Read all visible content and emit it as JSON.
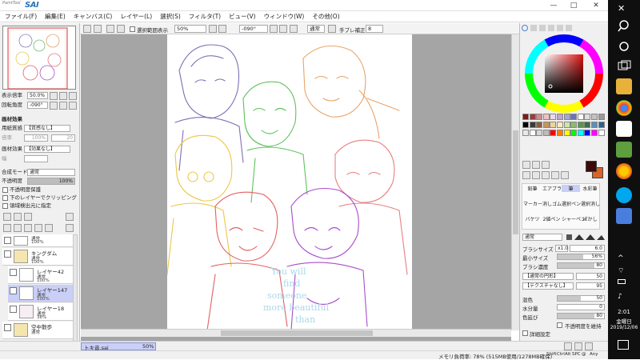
{
  "app": {
    "logo_small": "PaintTool",
    "logo_big": "SAI"
  },
  "window_buttons": {
    "minimize": "—",
    "maximize": "□",
    "close": "✕"
  },
  "menu": [
    "ファイル(F)",
    "編集(E)",
    "キャンバス(C)",
    "レイヤー(L)",
    "選択(S)",
    "フィルタ(T)",
    "ビュー(V)",
    "ウィンドウ(W)",
    "その他(O)"
  ],
  "toolbar": {
    "selection_display_label": "選択範囲表示",
    "zoom": "50%",
    "rotation": "-090°",
    "blend": "通常",
    "stabilizer_label": "手ブレ補正",
    "stabilizer_value": "8"
  },
  "navigator": {
    "zoom_label": "表示倍率",
    "zoom_value": "50.0%",
    "angle_label": "回転角度",
    "angle_value": "-090°"
  },
  "texture": {
    "section": "画材効果",
    "paper_label": "用紙質感",
    "paper_value": "【質感なし】",
    "paper_scale_label": "倍率",
    "paper_scale_value": "100%",
    "paper_strength_value": "20",
    "effect_label": "画材効果",
    "effect_value": "【効果なし】",
    "effect_scale_label": "幅"
  },
  "layer_settings": {
    "mode_label": "合成モード",
    "mode_value": "通常",
    "opacity_label": "不透明度",
    "opacity_value": "100%",
    "opts": [
      "不透明度保護",
      "下のレイヤーでクリッピング",
      "領域検出元に指定"
    ]
  },
  "layers": [
    {
      "name": "",
      "mode": "通常",
      "opacity": "100%",
      "kind": "top"
    },
    {
      "name": "キングダム",
      "mode": "通常",
      "opacity": "100%",
      "kind": "folder"
    },
    {
      "name": "レイヤー42",
      "mode": "通常",
      "opacity": "100%",
      "kind": "layer"
    },
    {
      "name": "レイヤー147",
      "mode": "通常",
      "opacity": "100%",
      "kind": "layer",
      "selected": true
    },
    {
      "name": "レイヤー18",
      "mode": "通常",
      "opacity": "38%",
      "kind": "layer"
    },
    {
      "name": "空中散歩",
      "mode": "通常",
      "opacity": "",
      "kind": "folder"
    }
  ],
  "canvas_text": [
    "You will",
    "find",
    "someone",
    "more beautiful",
    "than"
  ],
  "document_tab": {
    "name": "トキ音.sai",
    "zoom": "50%"
  },
  "status": {
    "memory": "メモリ負荷率: 78% (515MB使用/1278MB確保)",
    "keys": [
      "Shift",
      "Ctrl",
      "Alt",
      "SPC",
      "@",
      "Any"
    ]
  },
  "colors": {
    "accent": "#2a72b8",
    "selected_layer": "#c9cff6",
    "fg": "#3b0a0a",
    "bg": "#d8632a"
  },
  "palette": [
    "#7a1a1a",
    "#9c3b3b",
    "#d08b8b",
    "#f1c1c1",
    "#e7dbe9",
    "#c3a2cf",
    "#9fa9d6",
    "#6b74b8",
    "#ffffff",
    "#dedede",
    "#c2c2c2",
    "#9a9a9a",
    "#000000",
    "#3b3b3b",
    "#8b5d3b",
    "#c4975d",
    "#f0d39c",
    "#f5edbe",
    "#cfe7a3",
    "#8dbc6f",
    "#5a9450",
    "#3b6e4a",
    "#5e8fb8",
    "#2f5f8f",
    "#e8e8e8",
    "#ffffff",
    "#d6d6d6",
    "#bcbcbc",
    "#ff0000",
    "#ff8000",
    "#ffff00",
    "#00ff00",
    "#00ffff",
    "#0000ff",
    "#ff00ff",
    "#ffffff"
  ],
  "tools": {
    "row1": [
      "鉛筆",
      "エアブラシ",
      "筆",
      "水彩筆"
    ],
    "row2": [
      "マーカー",
      "消しゴム",
      "選択ペン",
      "選択消し"
    ],
    "row3": [
      "バケツ",
      "2値ペン",
      "シャーペン",
      "ぼかし"
    ]
  },
  "brush": {
    "mode": "通常",
    "size_label": "ブラシサイズ",
    "size_mult": "x1.0",
    "size_value": "6.0",
    "min_label": "最小サイズ",
    "min_value": "56%",
    "min_fraction": 0.56,
    "density_label": "ブラシ濃度",
    "density_value": "80",
    "density_fraction": 0.8,
    "shape": "【通常の円形】",
    "shape_value": "50",
    "tex": "【テクスチャなし】",
    "tex_value": "95",
    "blend_label": "混色",
    "blend_value": "50",
    "blend_fraction": 0.5,
    "water_label": "水分量",
    "water_value": "0",
    "water_fraction": 0.0,
    "stretch_label": "色延び",
    "stretch_value": "80",
    "stretch_fraction": 0.8,
    "keep_opacity": "不透明度を維持",
    "detail": "詳細設定"
  },
  "clock": {
    "time": "2:01",
    "day": "金曜日",
    "date": "2019/12/06"
  },
  "taskbar_icons": [
    "close-icon",
    "search-icon",
    "cortana-icon",
    "taskview-icon",
    "folder-icon",
    "chrome-icon",
    "sai-icon",
    "paint-icon",
    "firefox-icon",
    "skype-icon",
    "app-icon"
  ]
}
